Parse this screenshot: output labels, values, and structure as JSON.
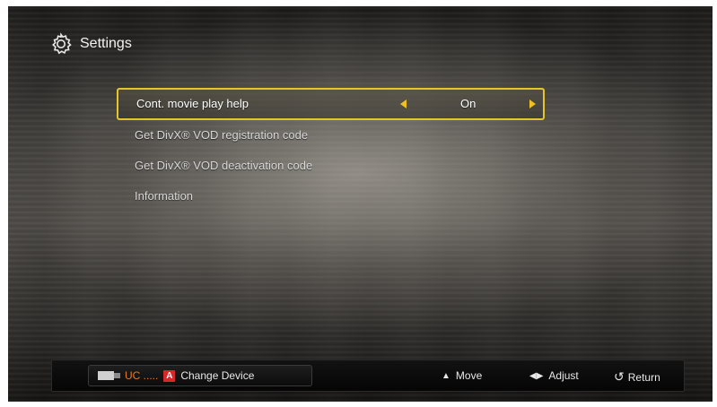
{
  "header": {
    "title": "Settings",
    "icon": "gear-icon"
  },
  "menu": {
    "items": [
      {
        "label": "Cont. movie play help",
        "value": "On",
        "selected": true
      },
      {
        "label": "Get DivX® VOD registration code"
      },
      {
        "label": "Get DivX® VOD deactivation code"
      },
      {
        "label": "Information"
      }
    ]
  },
  "footer": {
    "device_name": "UC .....",
    "a_key": "A",
    "change_device": "Change Device",
    "move": "Move",
    "adjust": "Adjust",
    "return": "Return"
  },
  "colors": {
    "accent": "#e3c62a",
    "device_text": "#e87a22",
    "a_key": "#d22a2a"
  }
}
